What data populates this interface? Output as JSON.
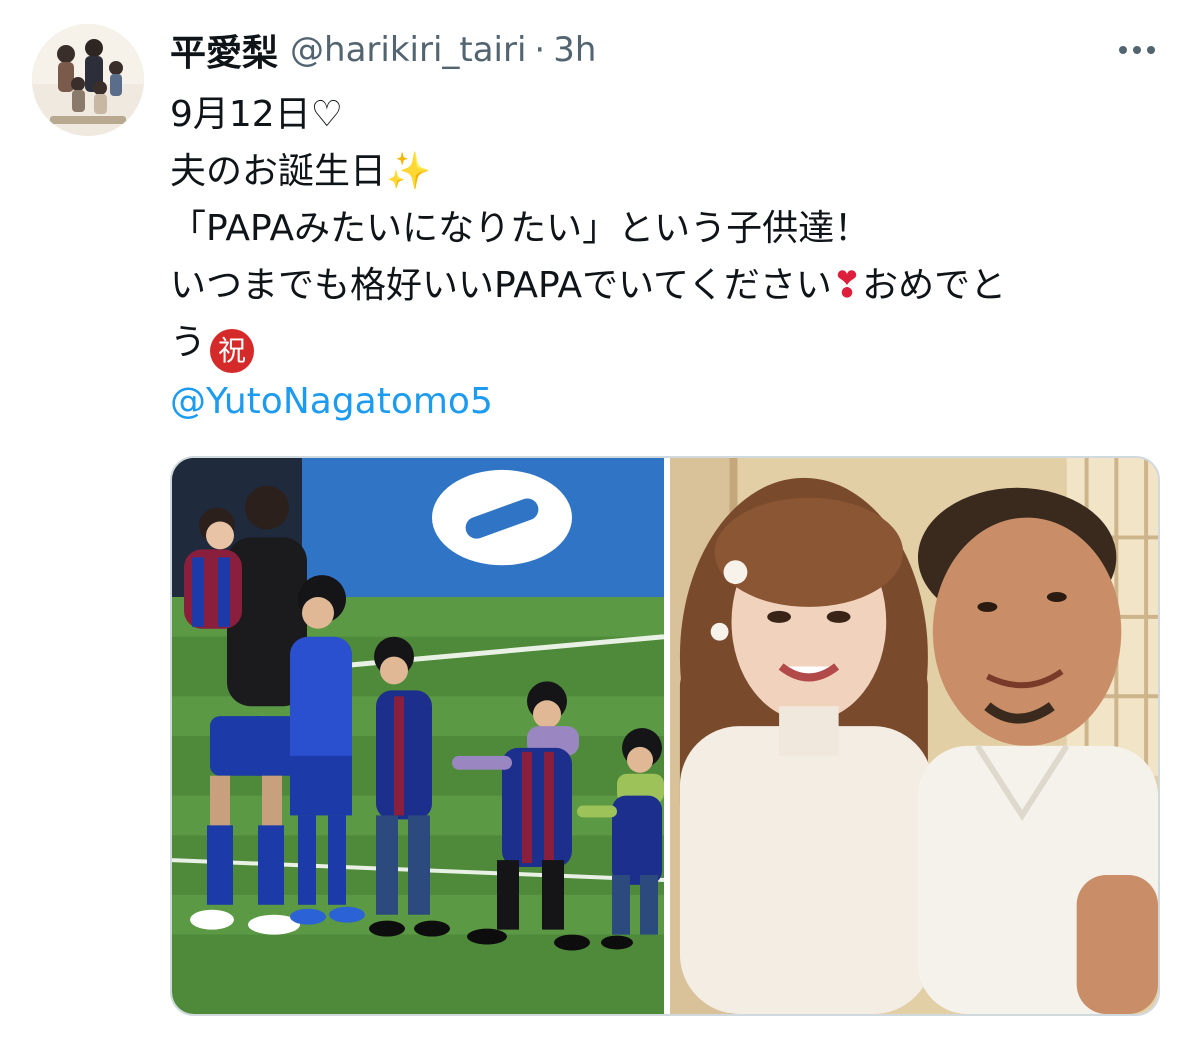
{
  "tweet": {
    "display_name": "平愛梨",
    "handle": "@harikiri_tairi",
    "separator": "·",
    "time": "3h",
    "lines": {
      "l1": "9月12日♡",
      "l2": "夫のお誕生日",
      "l3": "「PAPAみたいになりたい」という子供達！",
      "l4a": "いつまでも格好いいPAPAでいてください",
      "l4b": "おめでと",
      "l5": "う"
    },
    "emoji": {
      "sparkle": "✨",
      "heart": "❣",
      "iwai": "祝"
    },
    "mention": "@YutoNagatomo5"
  },
  "icons": {
    "more": "more-horizontal-icon",
    "sparkle": "sparkles-icon",
    "heart": "heart-exclamation-icon",
    "iwai": "congratulations-circle-icon"
  },
  "colors": {
    "link": "#1d9bf0",
    "secondary_text": "#536471",
    "iwai_red": "#d42a2a"
  }
}
